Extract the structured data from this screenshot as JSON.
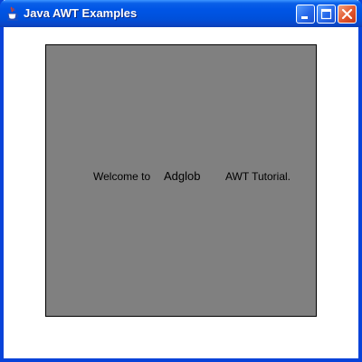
{
  "window": {
    "title": "Java AWT Examples",
    "icon": "java-cup-icon",
    "controls": {
      "minimize_icon": "minimize-icon",
      "maximize_icon": "maximize-icon",
      "close_icon": "close-icon"
    }
  },
  "panel": {
    "background_color": "#808080",
    "labels": [
      {
        "text": "Welcome to"
      },
      {
        "text": "Adglob"
      },
      {
        "text": "AWT Tutorial."
      }
    ]
  },
  "colors": {
    "titlebar": "#0055e5",
    "close_button": "#e2552b",
    "window_frame": "#0843d9"
  }
}
